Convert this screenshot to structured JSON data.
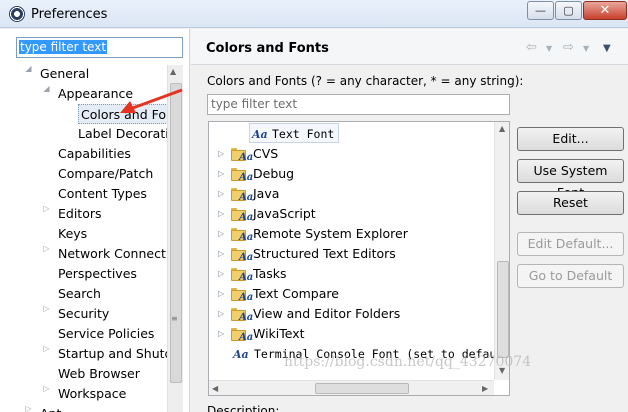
{
  "window": {
    "title": "Preferences",
    "min": "—",
    "max": "▢",
    "close": "✕"
  },
  "left": {
    "filter_text": "type filter text",
    "tree": [
      {
        "label": "General",
        "level": 0,
        "expander": "◢"
      },
      {
        "label": "Appearance",
        "level": 1,
        "expander": "◢"
      },
      {
        "label": "Colors and Fonts",
        "level": 2,
        "expander": "",
        "selected": true
      },
      {
        "label": "Label Decorations",
        "level": 2,
        "expander": ""
      },
      {
        "label": "Capabilities",
        "level": 1,
        "expander": ""
      },
      {
        "label": "Compare/Patch",
        "level": 1,
        "expander": ""
      },
      {
        "label": "Content Types",
        "level": 1,
        "expander": ""
      },
      {
        "label": "Editors",
        "level": 1,
        "expander": "▷"
      },
      {
        "label": "Keys",
        "level": 1,
        "expander": ""
      },
      {
        "label": "Network Connections",
        "level": 1,
        "expander": "▷"
      },
      {
        "label": "Perspectives",
        "level": 1,
        "expander": ""
      },
      {
        "label": "Search",
        "level": 1,
        "expander": ""
      },
      {
        "label": "Security",
        "level": 1,
        "expander": "▷"
      },
      {
        "label": "Service Policies",
        "level": 1,
        "expander": ""
      },
      {
        "label": "Startup and Shutdown",
        "level": 1,
        "expander": "▷"
      },
      {
        "label": "Web Browser",
        "level": 1,
        "expander": ""
      },
      {
        "label": "Workspace",
        "level": 1,
        "expander": "▷"
      },
      {
        "label": "Ant",
        "level": 0,
        "expander": "▷"
      }
    ]
  },
  "right": {
    "title": "Colors and Fonts",
    "description": "Colors and Fonts (? = any character, * = any string):",
    "filter_placeholder": "type filter text",
    "font_glyph": "Aa",
    "items": [
      {
        "label": "Text Font",
        "type": "font",
        "expander": ""
      },
      {
        "label": "CVS",
        "type": "folder",
        "expander": "▷"
      },
      {
        "label": "Debug",
        "type": "folder",
        "expander": "▷"
      },
      {
        "label": "Java",
        "type": "folder",
        "expander": "▷"
      },
      {
        "label": "JavaScript",
        "type": "folder",
        "expander": "▷"
      },
      {
        "label": "Remote System Explorer",
        "type": "folder",
        "expander": "▷"
      },
      {
        "label": "Structured Text Editors",
        "type": "folder",
        "expander": "▷"
      },
      {
        "label": "Tasks",
        "type": "folder",
        "expander": "▷"
      },
      {
        "label": "Text Compare",
        "type": "folder",
        "expander": "▷"
      },
      {
        "label": "View and Editor Folders",
        "type": "folder",
        "expander": "▷"
      },
      {
        "label": "WikiText",
        "type": "folder",
        "expander": "▷"
      },
      {
        "label": "Terminal Console Font (set to default: Text Font)",
        "type": "font",
        "expander": ""
      }
    ],
    "buttons": {
      "edit": "Edit...",
      "use_system_font": "Use System Font",
      "reset": "Reset",
      "edit_default": "Edit Default...",
      "go_to_default": "Go to Default"
    },
    "description_label": "Description:",
    "watermark": "https://blog.csdn.net/qq_43270074"
  }
}
